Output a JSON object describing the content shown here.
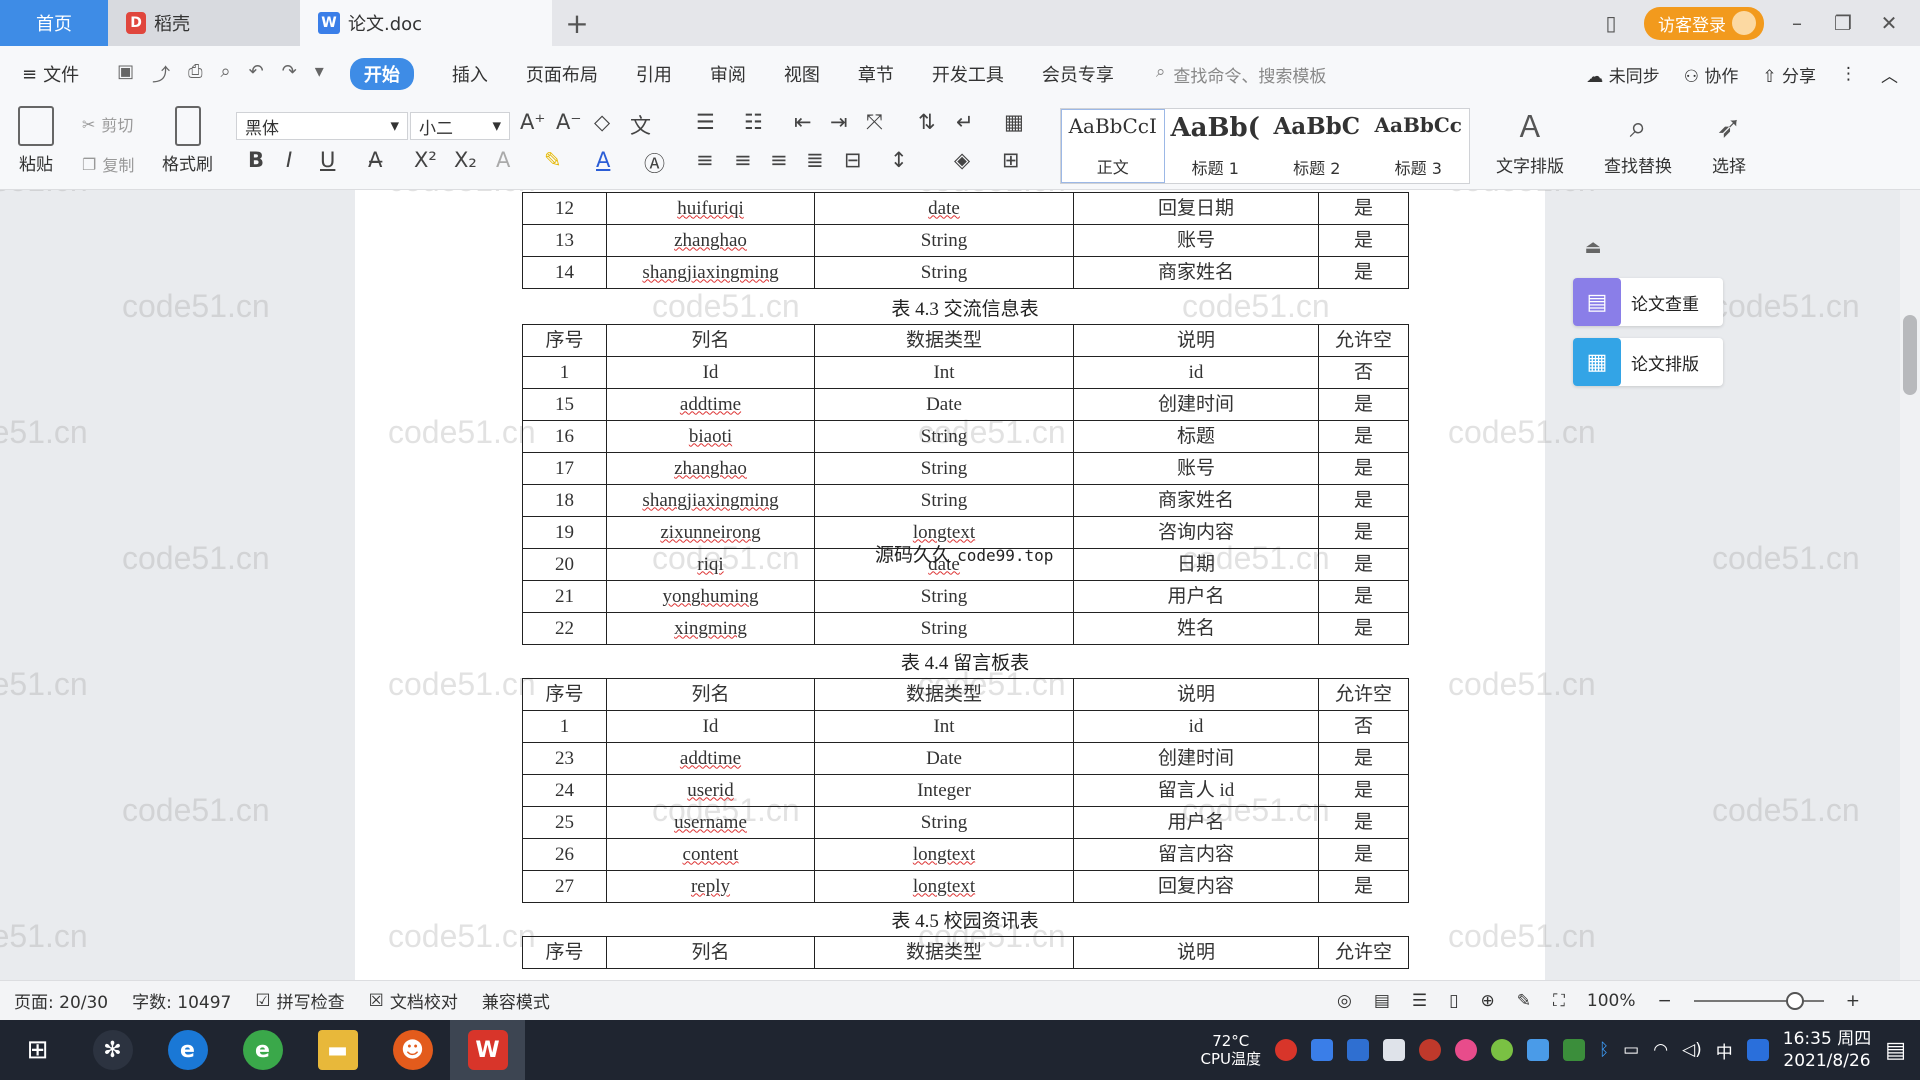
{
  "titlebar": {
    "tabs": [
      {
        "label": "首页"
      },
      {
        "label": "稻壳"
      },
      {
        "label": "论文.doc"
      }
    ],
    "new_tab": "+",
    "guest_login": "访客登录"
  },
  "menu": {
    "file": "文件",
    "items": [
      "开始",
      "插入",
      "页面布局",
      "引用",
      "审阅",
      "视图",
      "章节",
      "开发工具",
      "会员专享"
    ],
    "active": "开始",
    "search_placeholder": "查找命令、搜索模板",
    "sync": "未同步",
    "collab": "协作",
    "share": "分享"
  },
  "ribbon": {
    "paste": "粘贴",
    "cut": "剪切",
    "copy": "复制",
    "format_painter": "格式刷",
    "font": "黑体",
    "size": "小二",
    "styles": [
      {
        "preview": "AaBbCcI",
        "label": "正文"
      },
      {
        "preview": "AaBb(",
        "label": "标题 1"
      },
      {
        "preview": "AaBbC",
        "label": "标题 2"
      },
      {
        "preview": "AaBbCc",
        "label": "标题 3"
      }
    ],
    "text_layout": "文字排版",
    "find_replace": "查找替换",
    "select": "选择"
  },
  "document": {
    "table_top_rows": [
      [
        "12",
        "huifuriqi",
        "date",
        "回复日期",
        "是"
      ],
      [
        "13",
        "zhanghao",
        "String",
        "账号",
        "是"
      ],
      [
        "14",
        "shangjiaxingming",
        "String",
        "商家姓名",
        "是"
      ]
    ],
    "table_4_3": {
      "caption": "表 4.3 交流信息表",
      "header": [
        "序号",
        "列名",
        "数据类型",
        "说明",
        "允许空"
      ],
      "rows": [
        [
          "1",
          "Id",
          "Int",
          "id",
          "否"
        ],
        [
          "15",
          "addtime",
          "Date",
          "创建时间",
          "是"
        ],
        [
          "16",
          "biaoti",
          "String",
          "标题",
          "是"
        ],
        [
          "17",
          "zhanghao",
          "String",
          "账号",
          "是"
        ],
        [
          "18",
          "shangjiaxingming",
          "String",
          "商家姓名",
          "是"
        ],
        [
          "19",
          "zixunneirong",
          "longtext",
          "咨询内容",
          "是"
        ],
        [
          "20",
          "riqi",
          "date",
          "日期",
          "是"
        ],
        [
          "21",
          "yonghuming",
          "String",
          "用户名",
          "是"
        ],
        [
          "22",
          "xingming",
          "String",
          "姓名",
          "是"
        ]
      ]
    },
    "table_4_4": {
      "caption": "表 4.4 留言板表",
      "header": [
        "序号",
        "列名",
        "数据类型",
        "说明",
        "允许空"
      ],
      "rows": [
        [
          "1",
          "Id",
          "Int",
          "id",
          "否"
        ],
        [
          "23",
          "addtime",
          "Date",
          "创建时间",
          "是"
        ],
        [
          "24",
          "userid",
          "Integer",
          "留言人 id",
          "是"
        ],
        [
          "25",
          "username",
          "String",
          "用户名",
          "是"
        ],
        [
          "26",
          "content",
          "longtext",
          "留言内容",
          "是"
        ],
        [
          "27",
          "reply",
          "longtext",
          "回复内容",
          "是"
        ]
      ]
    },
    "table_4_5": {
      "caption": "表 4.5 校园资讯表",
      "header": [
        "序号",
        "列名",
        "数据类型",
        "说明",
        "允许空"
      ]
    },
    "overlay_text": "源码久久",
    "overlay_url": "code99.top",
    "watermark": "code51.cn"
  },
  "side_panel": {
    "check": "论文查重",
    "layout": "论文排版"
  },
  "status": {
    "page": "页面: 20/30",
    "words": "字数: 10497",
    "spell": "拼写检查",
    "proof": "文档校对",
    "compat": "兼容模式",
    "zoom": "100%"
  },
  "taskbar": {
    "temp": "72°C",
    "cpu_label": "CPU温度",
    "ime": "中",
    "time": "16:35 周四",
    "date": "2021/8/26"
  },
  "colors": {
    "accent": "#3e8ce6",
    "guest": "#f29a1d",
    "taskbar": "#1f2530"
  }
}
